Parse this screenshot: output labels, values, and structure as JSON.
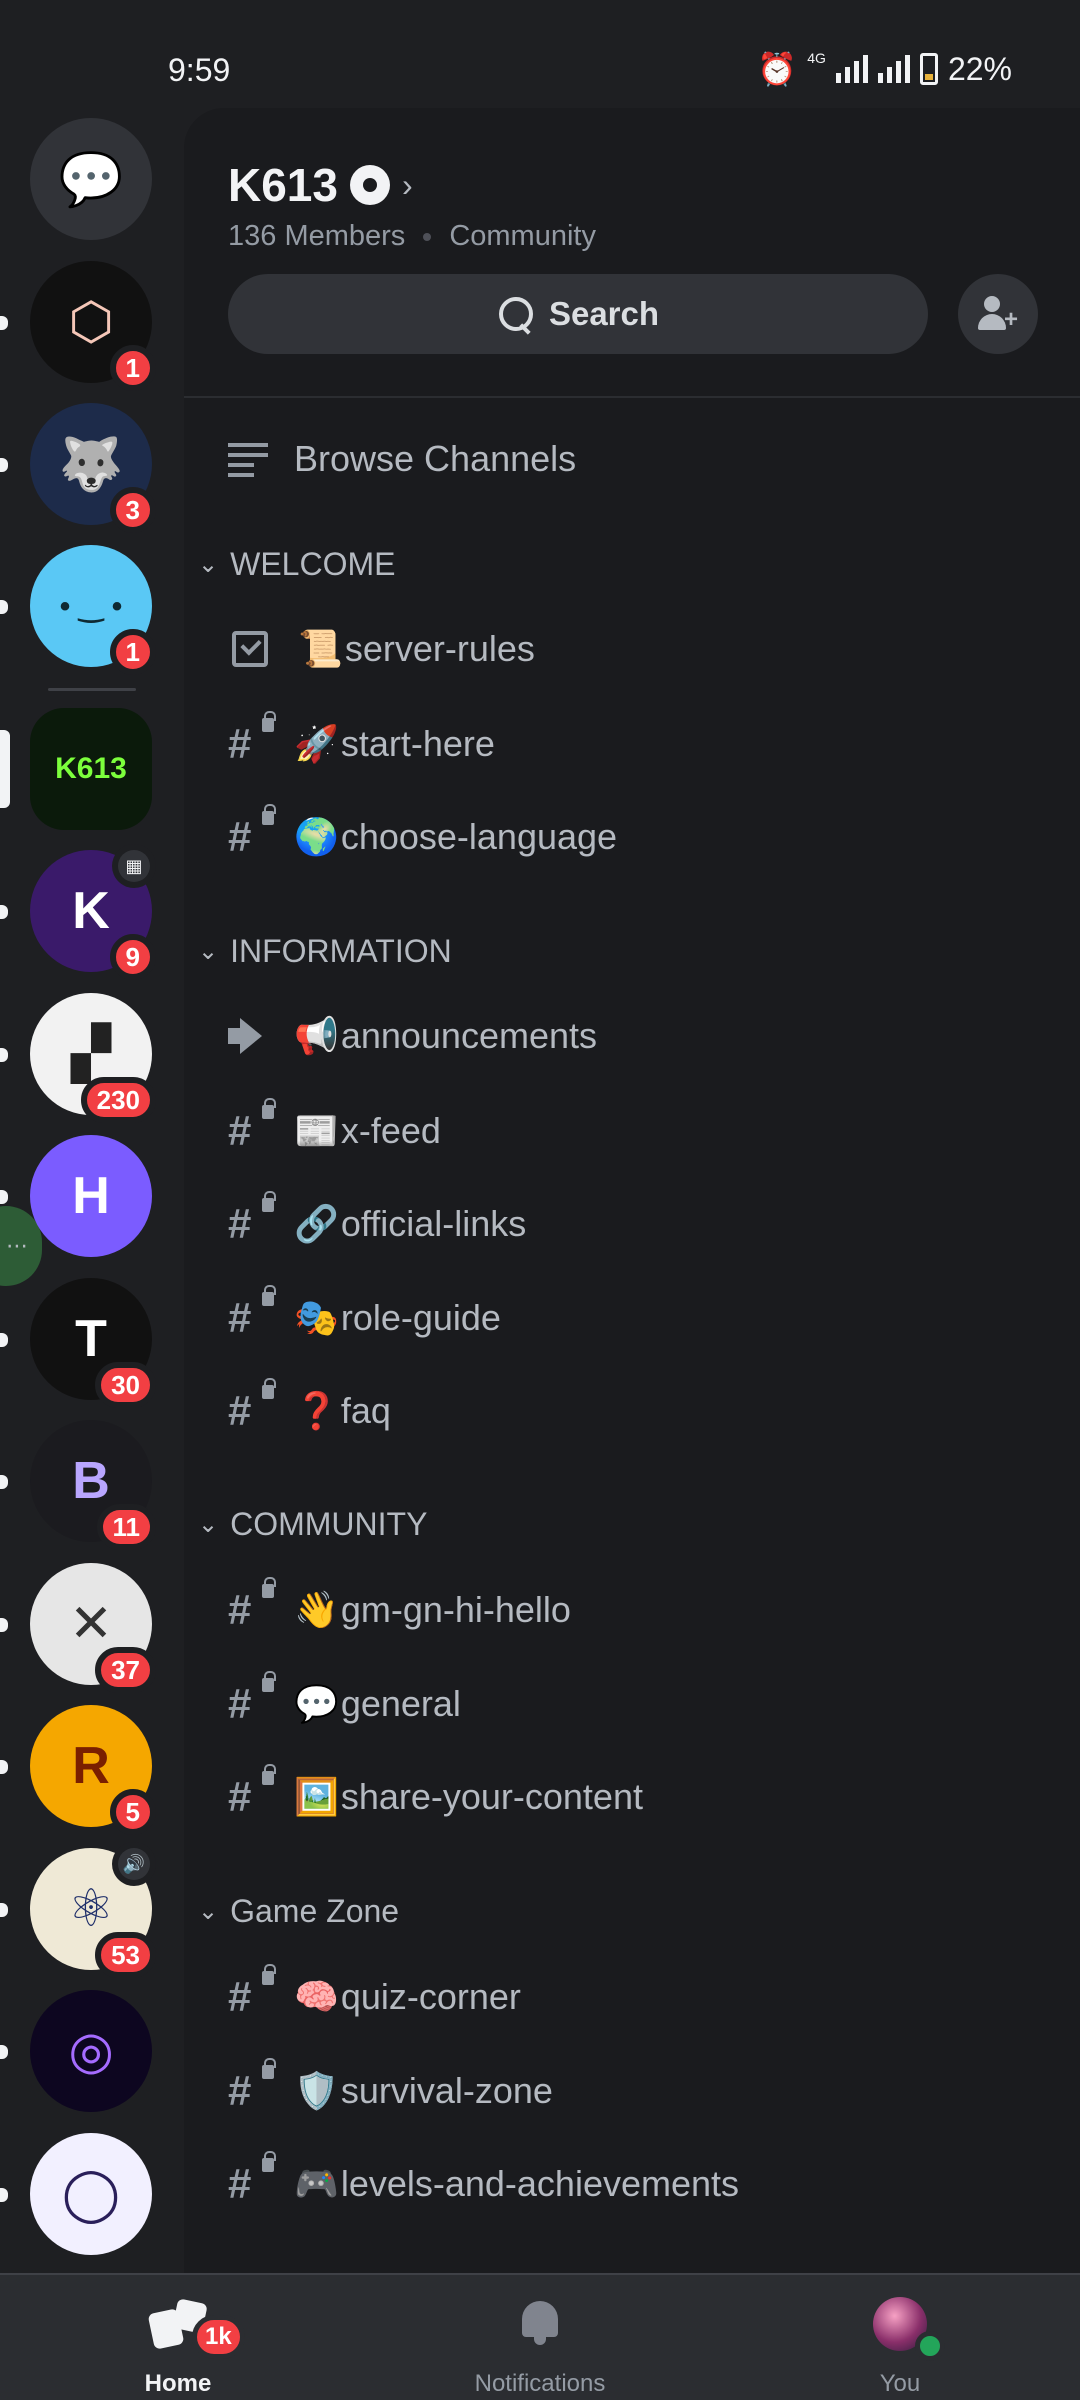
{
  "status_bar": {
    "time": "9:59",
    "battery": "22%",
    "network": "4G"
  },
  "rail": {
    "servers": [
      {
        "name": "direct-messages",
        "badge": "",
        "bg": "#313338",
        "fg": "#b5bac1",
        "glyph": "💬"
      },
      {
        "name": "server-1",
        "badge": "1",
        "bg": "#111111",
        "fg": "#f5c7b8",
        "glyph": "⬡"
      },
      {
        "name": "server-wolf",
        "badge": "3",
        "bg": "#1d2b4a",
        "fg": "#7fb0ff",
        "glyph": "🐺"
      },
      {
        "name": "server-blue-face",
        "badge": "1",
        "bg": "#5ac8f5",
        "fg": "#0f2a33",
        "glyph": "• ‿ •"
      },
      {
        "name": "server-k613",
        "badge": "",
        "bg": "#0b1a0b",
        "fg": "#7cff3c",
        "glyph": "K613",
        "selected": true
      },
      {
        "name": "server-kk",
        "badge": "9",
        "bg": "#3a1a6a",
        "fg": "#ffffff",
        "glyph": "K",
        "event": true
      },
      {
        "name": "server-checker",
        "badge": "230",
        "bg": "#f2f2f2",
        "fg": "#222222",
        "glyph": "▞"
      },
      {
        "name": "server-h",
        "badge": "",
        "bg": "#7b5cff",
        "fg": "#ffffff",
        "glyph": "H"
      },
      {
        "name": "server-t",
        "badge": "30",
        "bg": "#111111",
        "fg": "#ffffff",
        "glyph": "T"
      },
      {
        "name": "server-b",
        "badge": "11",
        "bg": "#1b1b1f",
        "fg": "#b9a6ff",
        "glyph": "B"
      },
      {
        "name": "server-x",
        "badge": "37",
        "bg": "#e6e6e6",
        "fg": "#333333",
        "glyph": "✕"
      },
      {
        "name": "server-r",
        "badge": "5",
        "bg": "#f5a700",
        "fg": "#7a1f00",
        "glyph": "R"
      },
      {
        "name": "server-atom",
        "badge": "53",
        "bg": "#efe9d6",
        "fg": "#1f2f6a",
        "glyph": "⚛",
        "voice": true
      },
      {
        "name": "server-purple-ring",
        "badge": "",
        "bg": "#0d0620",
        "fg": "#a56bff",
        "glyph": "◎"
      },
      {
        "name": "server-circle",
        "badge": "",
        "bg": "#f2f0ff",
        "fg": "#2a1f5a",
        "glyph": "◯"
      }
    ]
  },
  "server": {
    "name": "K613",
    "members": "136 Members",
    "type": "Community",
    "search_label": "Search"
  },
  "browse_label": "Browse Channels",
  "categories": [
    {
      "label": "WELCOME",
      "channels": [
        {
          "icon": "rules",
          "emoji": "📜",
          "name": "server-rules"
        },
        {
          "icon": "hash-lock",
          "emoji": "🚀",
          "name": "start-here"
        },
        {
          "icon": "hash-lock",
          "emoji": "🌍",
          "name": "choose-language"
        }
      ]
    },
    {
      "label": "INFORMATION",
      "channels": [
        {
          "icon": "announce",
          "emoji": "📢",
          "name": "announcements"
        },
        {
          "icon": "hash-lock",
          "emoji": "📰",
          "name": "x-feed"
        },
        {
          "icon": "hash-lock",
          "emoji": "🔗",
          "name": "official-links"
        },
        {
          "icon": "hash-lock",
          "emoji": "🎭",
          "name": "role-guide"
        },
        {
          "icon": "hash-lock",
          "emoji": "❓",
          "name": "faq"
        }
      ]
    },
    {
      "label": "COMMUNITY",
      "channels": [
        {
          "icon": "hash-lock",
          "emoji": "👋",
          "name": "gm-gn-hi-hello"
        },
        {
          "icon": "hash-lock",
          "emoji": "💬",
          "name": "general"
        },
        {
          "icon": "hash-lock",
          "emoji": "🖼️",
          "name": "share-your-content"
        }
      ]
    },
    {
      "label": "Game Zone",
      "channels": [
        {
          "icon": "hash-lock",
          "emoji": "🧠",
          "name": "quiz-corner"
        },
        {
          "icon": "hash-lock",
          "emoji": "🛡️",
          "name": "survival-zone"
        },
        {
          "icon": "hash-lock",
          "emoji": "🎮",
          "name": "levels-and-achievements"
        }
      ]
    }
  ],
  "bottom_nav": {
    "home": "Home",
    "home_badge": "1k",
    "notifications": "Notifications",
    "you": "You"
  },
  "colors": {
    "accent_red": "#f23f43",
    "online_green": "#23a55a",
    "panel_bg": "#1a1b1e",
    "rail_bg": "#1e1f22"
  }
}
